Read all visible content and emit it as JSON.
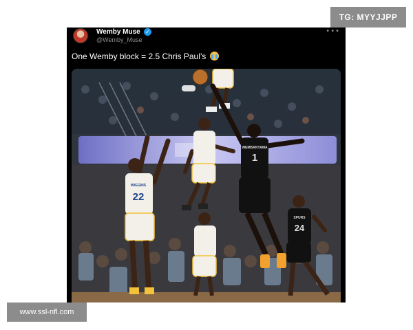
{
  "watermarks": {
    "top_right": "TG: MYYJJPP",
    "bottom_left": "www.ssl-nfl.com"
  },
  "tweet": {
    "display_name": "Wemby Muse",
    "handle": "@Wemby_Muse",
    "verified": true,
    "text": "One Wemby block = 2.5 Chris Paul’s",
    "emoji": "crying-face",
    "more_icon": "more-horizontal-icon"
  },
  "media": {
    "jersey_numbers": {
      "white_left": "22",
      "white_center": "",
      "black_center": "1",
      "black_right": "24"
    },
    "jersey_names": {
      "white_left": "WIGGINS",
      "black_center": "WEMBANYAMA",
      "black_right": "SPURS"
    }
  },
  "colors": {
    "tweet_background": "#000000",
    "verified_blue": "#1d9bf0",
    "warriors_white": "#f2f0e8",
    "warriors_gold": "#f3c13a",
    "spurs_black": "#111111",
    "court_floor": "#8a6a46"
  }
}
